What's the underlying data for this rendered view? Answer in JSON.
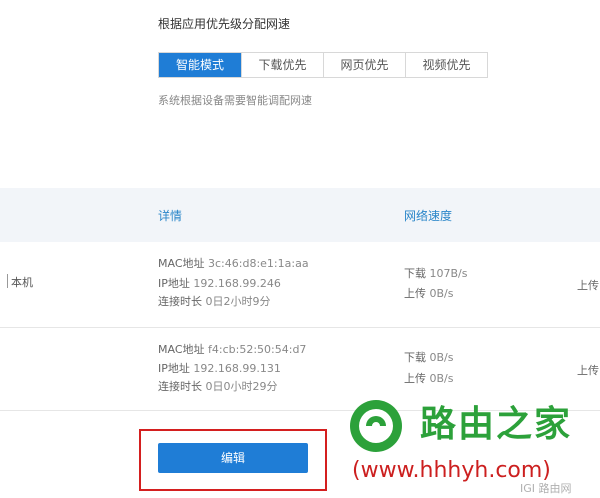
{
  "priority": {
    "title": "根据应用优先级分配网速",
    "tabs": [
      "智能模式",
      "下载优先",
      "网页优先",
      "视频优先"
    ],
    "active_tab": "智能模式",
    "hint": "系统根据设备需要智能调配网速"
  },
  "table": {
    "headers": {
      "detail": "详情",
      "speed": "网络速度"
    },
    "rows": [
      {
        "name": "本机",
        "mac_label": "MAC地址",
        "mac": "3c:46:d8:e1:1a:aa",
        "ip_label": "IP地址",
        "ip": "192.168.99.246",
        "dur_label": "连接时长",
        "dur": "0日2小时9分",
        "down_label": "下载",
        "down": "107B/s",
        "up_label": "上传",
        "up": "0B/s",
        "right_partial": "上传"
      },
      {
        "name": "",
        "mac_label": "MAC地址",
        "mac": "f4:cb:52:50:54:d7",
        "ip_label": "IP地址",
        "ip": "192.168.99.131",
        "dur_label": "连接时长",
        "dur": "0日0小时29分",
        "down_label": "下载",
        "down": "0B/s",
        "up_label": "上传",
        "up": "0B/s",
        "right_partial": "上传"
      }
    ]
  },
  "edit_button": "编辑",
  "watermark": {
    "brand": "路由之家",
    "url": "(www.hhhyh.com)",
    "small": "IGI 路由网"
  },
  "colors": {
    "accent": "#1f7dd6",
    "header_text": "#2a86c9",
    "highlight": "#d41f1f",
    "watermark_green": "#2ca13a"
  }
}
